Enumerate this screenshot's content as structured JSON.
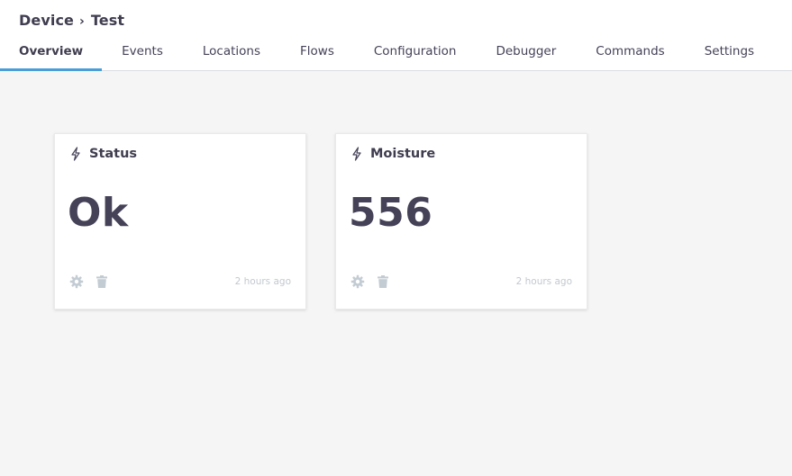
{
  "breadcrumb": {
    "parent": "Device",
    "separator": "›",
    "current": "Test"
  },
  "tabs": [
    {
      "label": "Overview",
      "active": true
    },
    {
      "label": "Events",
      "active": false
    },
    {
      "label": "Locations",
      "active": false
    },
    {
      "label": "Flows",
      "active": false
    },
    {
      "label": "Configuration",
      "active": false
    },
    {
      "label": "Debugger",
      "active": false
    },
    {
      "label": "Commands",
      "active": false
    },
    {
      "label": "Settings",
      "active": false
    }
  ],
  "cards": [
    {
      "title": "Status",
      "value": "Ok",
      "timestamp": "2 hours ago",
      "icon": "bolt-icon"
    },
    {
      "title": "Moisture",
      "value": "556",
      "timestamp": "2 hours ago",
      "icon": "bolt-icon"
    }
  ],
  "colors": {
    "accent": "#4a9ed8",
    "text": "#454258",
    "muted": "#c3c8cf",
    "background": "#f5f5f5"
  }
}
